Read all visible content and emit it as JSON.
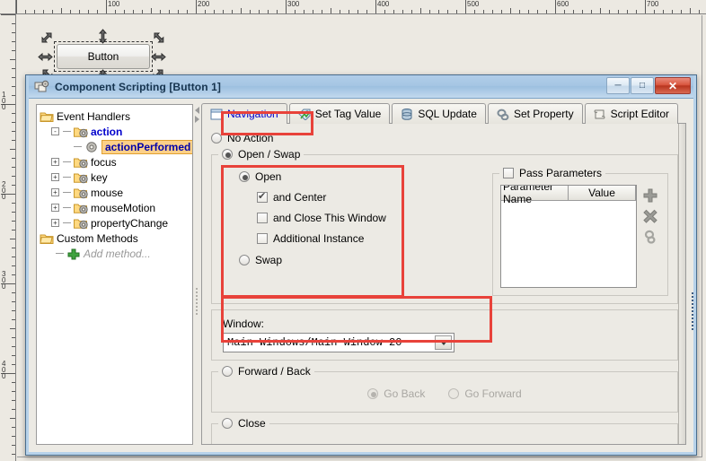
{
  "designer": {
    "button_label": "Button",
    "ruler_h_labels": [
      "100",
      "200",
      "300",
      "400",
      "500",
      "600",
      "700"
    ],
    "ruler_v_labels": [
      "100",
      "200",
      "300",
      "400"
    ]
  },
  "dialog": {
    "title": "Component Scripting [Button 1]",
    "title_icon": "script-components-icon",
    "window_buttons": [
      {
        "name": "minimize-button",
        "glyph": "─"
      },
      {
        "name": "maximize-button",
        "glyph": "□"
      },
      {
        "name": "close-button",
        "glyph": "✕"
      }
    ]
  },
  "tree": {
    "nodes": [
      {
        "label": "Event Handlers",
        "icon": "folder-icon",
        "indent": 0,
        "expander": "none",
        "style": "plain"
      },
      {
        "label": "action",
        "icon": "gear-folder-icon",
        "indent": 1,
        "expander": "-",
        "style": "blue"
      },
      {
        "label": "actionPerformed *",
        "icon": "gear-icon",
        "indent": 2,
        "expander": "none",
        "style": "selected"
      },
      {
        "label": "focus",
        "icon": "gear-folder-icon",
        "indent": 1,
        "expander": "+",
        "style": "plain"
      },
      {
        "label": "key",
        "icon": "gear-folder-icon",
        "indent": 1,
        "expander": "+",
        "style": "plain"
      },
      {
        "label": "mouse",
        "icon": "gear-folder-icon",
        "indent": 1,
        "expander": "+",
        "style": "plain"
      },
      {
        "label": "mouseMotion",
        "icon": "gear-folder-icon",
        "indent": 1,
        "expander": "+",
        "style": "plain"
      },
      {
        "label": "propertyChange",
        "icon": "gear-folder-icon",
        "indent": 1,
        "expander": "+",
        "style": "plain"
      },
      {
        "label": "Custom Methods",
        "icon": "folder-icon",
        "indent": 0,
        "expander": "none",
        "style": "plain"
      },
      {
        "label": "Add method...",
        "icon": "plus-icon",
        "indent": 1,
        "expander": "none",
        "style": "gray-italic"
      }
    ]
  },
  "tabs": [
    {
      "label": "Navigation",
      "icon": "window-icon",
      "active": true
    },
    {
      "label": "Set Tag Value",
      "icon": "tag-icon",
      "active": false
    },
    {
      "label": "SQL Update",
      "icon": "database-icon",
      "active": false
    },
    {
      "label": "Set Property",
      "icon": "property-icon",
      "active": false
    },
    {
      "label": "Script Editor",
      "icon": "scroll-icon",
      "active": false
    }
  ],
  "navigation": {
    "no_action": {
      "label": "No Action",
      "selected": false
    },
    "open_swap": {
      "label": "Open / Swap",
      "selected": true,
      "open": {
        "label": "Open",
        "selected": true
      },
      "and_center": {
        "label": "and Center",
        "checked": true
      },
      "and_close": {
        "label": "and Close This Window",
        "checked": false
      },
      "additional_instance": {
        "label": "Additional Instance",
        "checked": false
      },
      "swap": {
        "label": "Swap",
        "selected": false
      }
    },
    "pass_parameters": {
      "label": "Pass Parameters",
      "checked": false,
      "columns": [
        "Parameter Name",
        "Value"
      ],
      "rows": [],
      "actions": [
        {
          "name": "add-parameter-button",
          "icon": "plus-icon"
        },
        {
          "name": "delete-parameter-button",
          "icon": "x-icon"
        },
        {
          "name": "link-parameter-button",
          "icon": "link-icon"
        }
      ]
    },
    "window": {
      "label": "Window:",
      "value": "Main Windows/Main Window 20"
    },
    "forward_back": {
      "label": "Forward / Back",
      "selected": false,
      "go_back": {
        "label": "Go Back",
        "selected": true,
        "disabled": true
      },
      "go_forward": {
        "label": "Go Forward",
        "selected": false,
        "disabled": true
      }
    },
    "close": {
      "label": "Close",
      "selected": false
    }
  },
  "colors": {
    "highlight": "#e8423a",
    "accent_link": "#0000cc",
    "tree_selection": "#fcd088",
    "titlebar": "#a6c6e4"
  }
}
